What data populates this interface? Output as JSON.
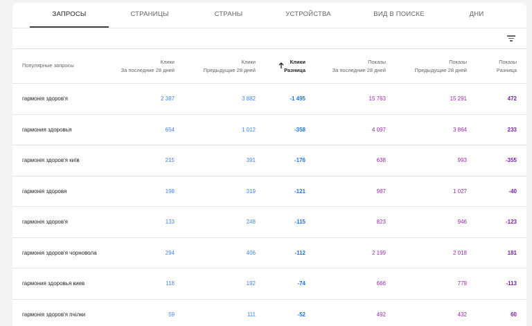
{
  "tabs": [
    {
      "label": "ЗАПРОСЫ",
      "active": true
    },
    {
      "label": "СТРАНИЦЫ",
      "active": false
    },
    {
      "label": "СТРАНЫ",
      "active": false
    },
    {
      "label": "УСТРОЙСТВА",
      "active": false
    },
    {
      "label": "ВИД В ПОИСКЕ",
      "active": false
    },
    {
      "label": "ДНИ",
      "active": false
    }
  ],
  "toolbar": {
    "filter_icon": "filter-list-icon"
  },
  "columns": [
    {
      "line1": "Популярные запросы",
      "line2": ""
    },
    {
      "line1": "Клики",
      "line2": "За последние 28 дней"
    },
    {
      "line1": "Клики",
      "line2": "Предыдущие 28 дней"
    },
    {
      "line1": "Клики",
      "line2": "Разница",
      "sorted": true,
      "sort_icon": "arrow-up-icon"
    },
    {
      "line1": "Показы",
      "line2": "За последние 28 дней"
    },
    {
      "line1": "Показы",
      "line2": "Предыдущие 28 дней"
    },
    {
      "line1": "Показы",
      "line2": "Разница"
    }
  ],
  "rows": [
    {
      "query": "гармонія здоров'я",
      "c28": "2 387",
      "cprev": "3 882",
      "cdiff": "-1 495",
      "i28": "15 763",
      "iprev": "15 291",
      "idiff": "472"
    },
    {
      "query": "гармония здоровья",
      "c28": "654",
      "cprev": "1 012",
      "cdiff": "-358",
      "i28": "4 097",
      "iprev": "3 864",
      "idiff": "233"
    },
    {
      "query": "гармонія здоров'я київ",
      "c28": "215",
      "cprev": "391",
      "cdiff": "-176",
      "i28": "638",
      "iprev": "993",
      "idiff": "-355"
    },
    {
      "query": "гармонія здоровя",
      "c28": "198",
      "cprev": "319",
      "cdiff": "-121",
      "i28": "987",
      "iprev": "1 027",
      "idiff": "-40"
    },
    {
      "query": "гармонія здоров'я",
      "c28": "133",
      "cprev": "248",
      "cdiff": "-115",
      "i28": "823",
      "iprev": "946",
      "idiff": "-123"
    },
    {
      "query": "гармонія здоров'я чорновола",
      "c28": "294",
      "cprev": "406",
      "cdiff": "-112",
      "i28": "2 199",
      "iprev": "2 018",
      "idiff": "181"
    },
    {
      "query": "гармония здоровья киев",
      "c28": "118",
      "cprev": "192",
      "cdiff": "-74",
      "i28": "666",
      "iprev": "779",
      "idiff": "-113"
    },
    {
      "query": "гармонія здоров'я пчілки",
      "c28": "59",
      "cprev": "111",
      "cdiff": "-52",
      "i28": "492",
      "iprev": "432",
      "idiff": "60"
    }
  ],
  "colors": {
    "clicks": "#4285f4",
    "clicks_diff": "#1a73e8",
    "impressions": "#9c27b0",
    "impressions_diff": "#7b1fa2"
  }
}
